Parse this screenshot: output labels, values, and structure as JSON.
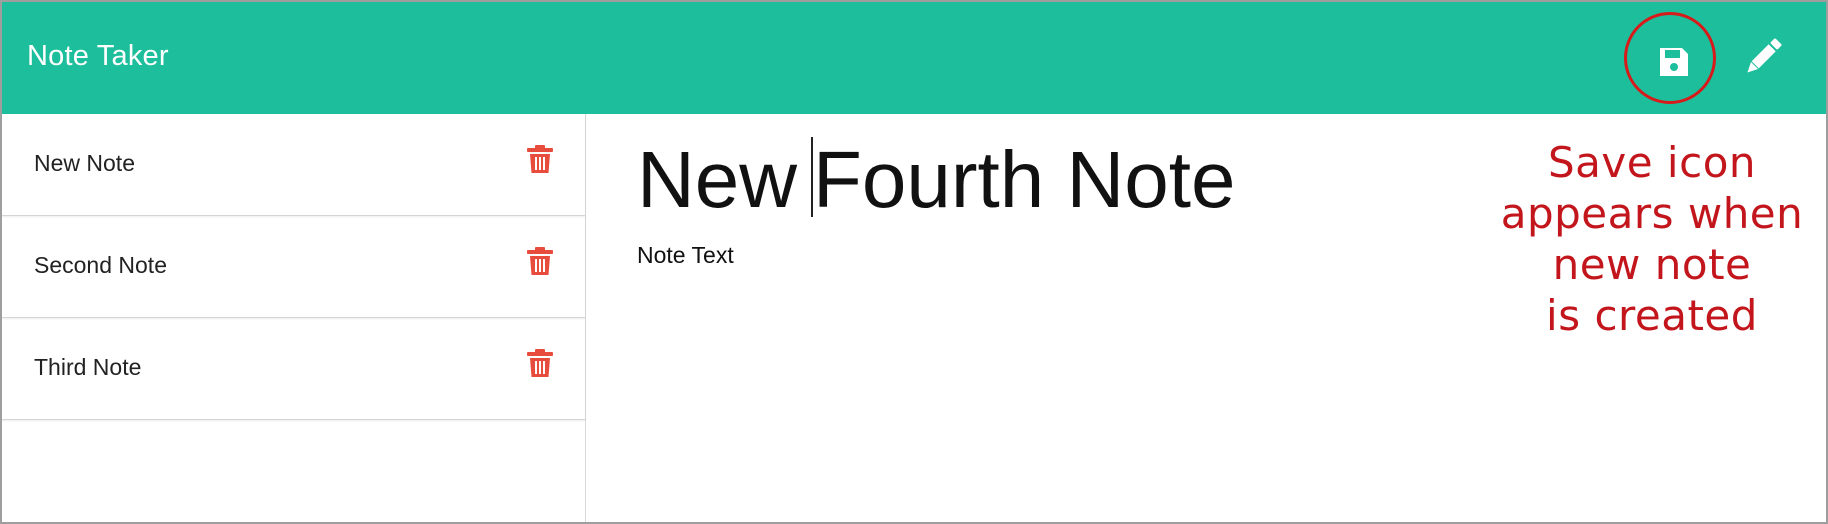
{
  "header": {
    "title": "Note Taker",
    "save_icon": "save-icon",
    "edit_icon": "pencil-icon",
    "background": "#1cbe9c"
  },
  "sidebar": {
    "notes": [
      {
        "title": "New Note",
        "delete_icon": "trash-icon"
      },
      {
        "title": "Second Note",
        "delete_icon": "trash-icon"
      },
      {
        "title": "Third Note",
        "delete_icon": "trash-icon"
      }
    ],
    "delete_color": "#e74c3c"
  },
  "editor": {
    "title_value_before_caret": "New",
    "title_value_after_caret": "Fourth Note",
    "text_placeholder": "Note Text"
  },
  "annotation": {
    "lines": [
      "Save icon",
      "appears when",
      "new note",
      "is created"
    ],
    "color": "#c3161c"
  }
}
